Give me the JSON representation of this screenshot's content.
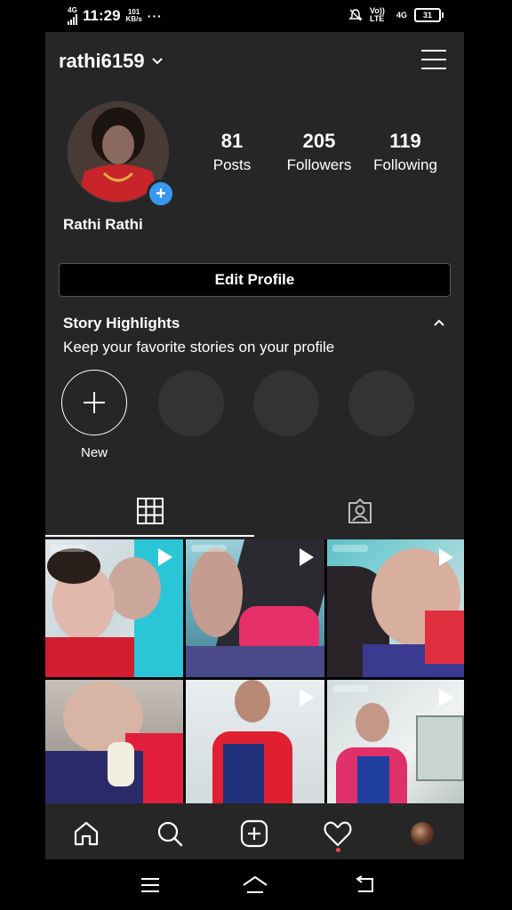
{
  "status": {
    "time": "11:29",
    "network_left": "4G",
    "speed_top": "101",
    "speed_bottom": "KB/s",
    "dots": "···",
    "volte": "Vo)) LTE",
    "network_right": "4G",
    "battery": "31"
  },
  "profile": {
    "username": "rathi6159",
    "full_name": "Rathi Rathi",
    "stats": [
      {
        "value": "81",
        "label": "Posts"
      },
      {
        "value": "205",
        "label": "Followers"
      },
      {
        "value": "119",
        "label": "Following"
      }
    ],
    "edit_label": "Edit Profile"
  },
  "highlights": {
    "title": "Story Highlights",
    "subtitle": "Keep your favorite stories on your profile",
    "new_label": "New"
  },
  "tabs": [
    {
      "icon": "grid-icon",
      "active": true
    },
    {
      "icon": "tagged-icon",
      "active": false
    }
  ],
  "bottom_nav": [
    "home-icon",
    "search-icon",
    "add-post-icon",
    "activity-heart-icon",
    "profile-avatar"
  ],
  "system_nav": [
    "menu-icon",
    "home-icon",
    "back-icon"
  ],
  "colors": {
    "background": "#262626",
    "accent_blue": "#3897f0",
    "notification_red": "#ed4956"
  }
}
